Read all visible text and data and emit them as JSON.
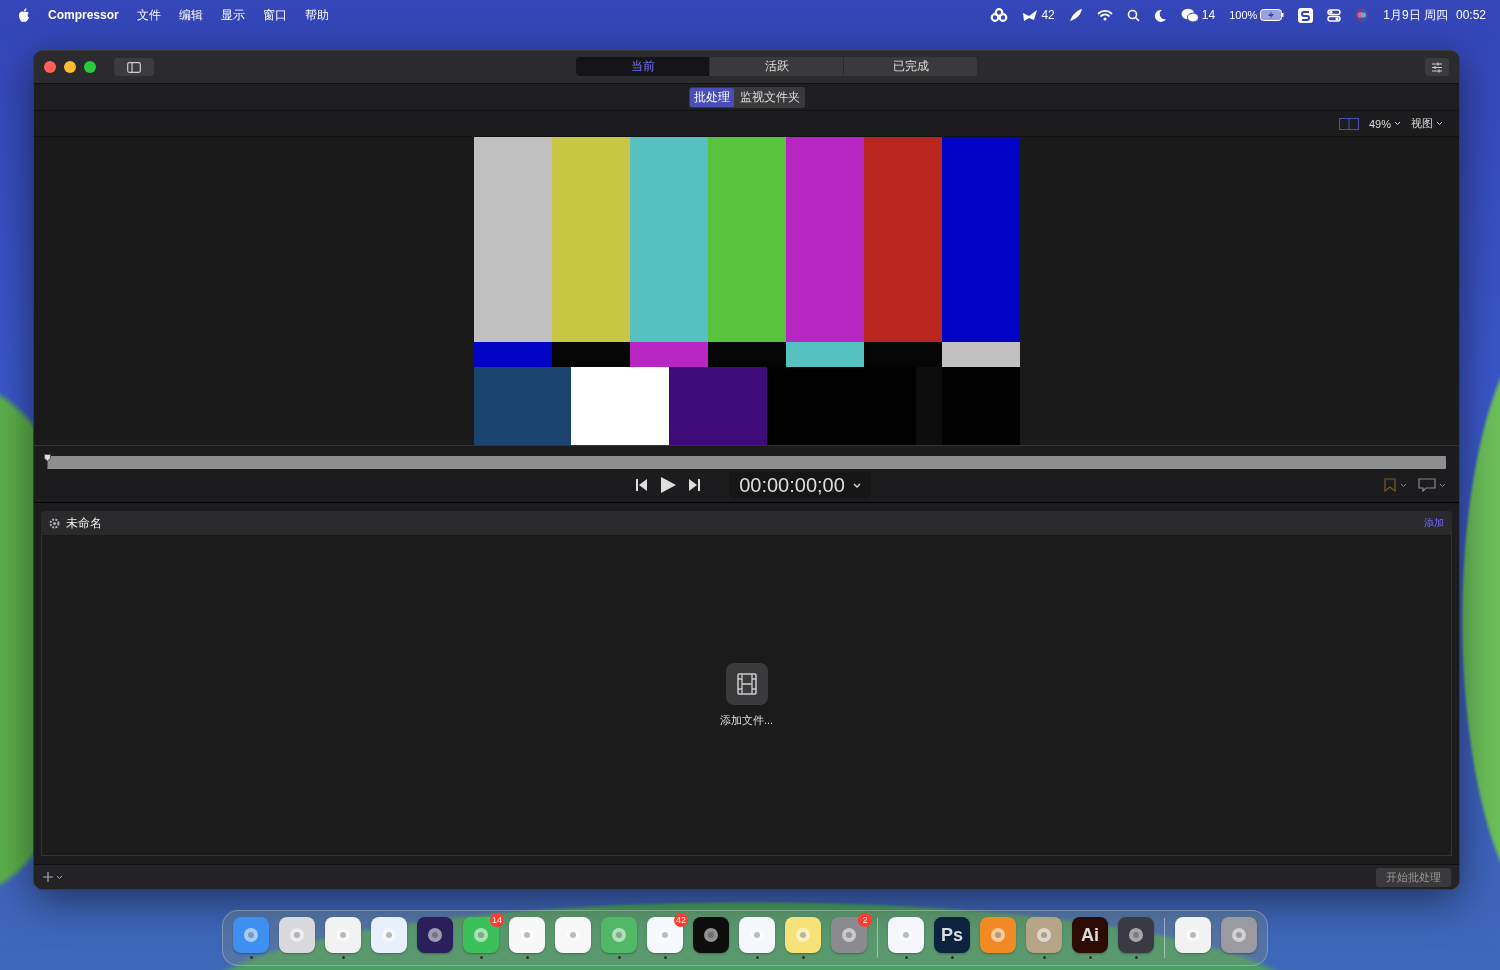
{
  "menu_bar": {
    "app_name": "Compressor",
    "menus": [
      "文件",
      "编辑",
      "显示",
      "窗口",
      "帮助"
    ],
    "status": [
      {
        "kind": "cloud"
      },
      {
        "kind": "plane",
        "text": "42"
      },
      {
        "kind": "feather"
      },
      {
        "kind": "wifi"
      },
      {
        "kind": "search"
      },
      {
        "kind": "moon"
      },
      {
        "kind": "chat",
        "text": "14"
      },
      {
        "kind": "battery",
        "text": "100%"
      },
      {
        "kind": "s"
      },
      {
        "kind": "toggles"
      },
      {
        "kind": "siri"
      }
    ],
    "date": "1月9日 周四",
    "time": "00:52"
  },
  "window": {
    "tabs": [
      {
        "label": "当前",
        "selected": true
      },
      {
        "label": "活跃",
        "selected": false
      },
      {
        "label": "已完成",
        "selected": false
      }
    ],
    "modes": [
      {
        "label": "批处理",
        "selected": true
      },
      {
        "label": "监视文件夹",
        "selected": false
      }
    ],
    "zoom": "49%",
    "view_menu": "视图",
    "timecode": "00:00:00;00",
    "batch": {
      "name": "未命名",
      "add": "添加",
      "add_files": "添加文件..."
    },
    "start_button": "开始批处理"
  },
  "dock": {
    "groups": [
      [
        {
          "color": "#3d8ff0",
          "running": true
        },
        {
          "color": "#d9d9de",
          "running": false
        },
        {
          "color": "#f2f2f2",
          "running": true
        },
        {
          "color": "#e8f0fb",
          "running": false
        },
        {
          "color": "#2a1f5a",
          "running": false
        },
        {
          "color": "#3cc15a",
          "badge": "14",
          "running": true
        },
        {
          "color": "#f7f7f7",
          "running": true
        },
        {
          "color": "#f7f7f7",
          "running": false
        },
        {
          "color": "#52b868",
          "running": true
        },
        {
          "color": "#f5f8fc",
          "badge": "42",
          "running": true
        },
        {
          "color": "#0d0d0d",
          "running": false
        },
        {
          "color": "#f4f7fb",
          "running": true
        },
        {
          "color": "#f7e27a",
          "running": true
        },
        {
          "color": "#8a8a8f",
          "badge": "2",
          "running": false
        }
      ],
      [
        {
          "color": "#f4f6fb",
          "running": true
        },
        {
          "color": "#0b2340",
          "glyph": "Ps",
          "running": true
        },
        {
          "color": "#f08a24",
          "running": false
        },
        {
          "color": "#b6a486",
          "running": true
        },
        {
          "color": "#2c0b05",
          "glyph": "Ai",
          "running": true
        },
        {
          "color": "#3a3a44",
          "running": true
        }
      ],
      [
        {
          "color": "#f2f2f2",
          "running": false
        },
        {
          "color": "#9a9aa0",
          "running": false
        }
      ]
    ]
  }
}
